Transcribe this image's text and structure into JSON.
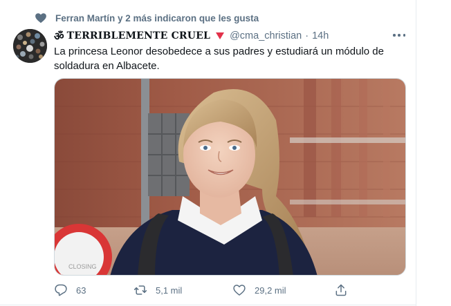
{
  "social_context": {
    "text": "Ferran Martín y 2 más indicaron que les gusta",
    "icon": "heart-icon"
  },
  "tweet": {
    "author": {
      "om_symbol": "ॐ",
      "display_name": "TERRIBLEMENTE CRUEL",
      "name_emoji": "red-triangle-down",
      "handle": "@cma_christian",
      "separator": "·",
      "time": "14h"
    },
    "text": "La princesa Leonor desobedece a sus padres y estudiará un módulo de soldadura en Albacete.",
    "media": {
      "description_icon": "photo",
      "sign_text": "CLOSING"
    },
    "actions": {
      "reply": {
        "icon": "reply-icon",
        "count": "63"
      },
      "retweet": {
        "icon": "retweet-icon",
        "count": "5,1 mil"
      },
      "like": {
        "icon": "like-icon",
        "count": "29,2 mil"
      },
      "share": {
        "icon": "share-icon"
      }
    }
  },
  "colors": {
    "secondary_text": "#5b7083",
    "primary_text": "#0f1419",
    "accent_red": "#e2314a",
    "divider": "#e6ecf0"
  }
}
